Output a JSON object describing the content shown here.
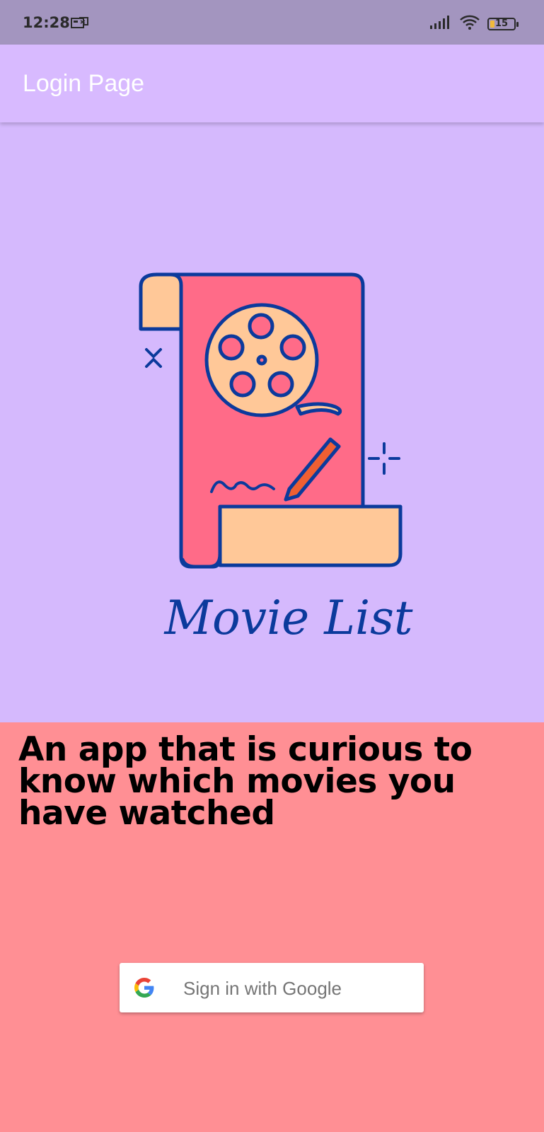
{
  "status_bar": {
    "time": "12:28",
    "battery_level": "15",
    "icons": [
      "notification-card-icon",
      "signal-icon",
      "wifi-icon",
      "battery-icon"
    ]
  },
  "app_bar": {
    "title": "Login Page"
  },
  "logo": {
    "caption": "Movie List",
    "icon": "film-reel-scroll-icon",
    "colors": {
      "background": "#d5b9fd",
      "scroll": "#ff6b88",
      "paper": "#ffc898",
      "outline": "#0b3a9c",
      "pencil": "#f05f32"
    }
  },
  "main": {
    "tagline": "An app that is curious to know which movies you have watched"
  },
  "sign_in": {
    "label": "Sign in with Google",
    "icon": "google-g-icon"
  },
  "colors": {
    "status_bar": "#a395bf",
    "app_bar": "#d8baff",
    "page_background": "#ff8f94",
    "button": "#ffffff"
  }
}
